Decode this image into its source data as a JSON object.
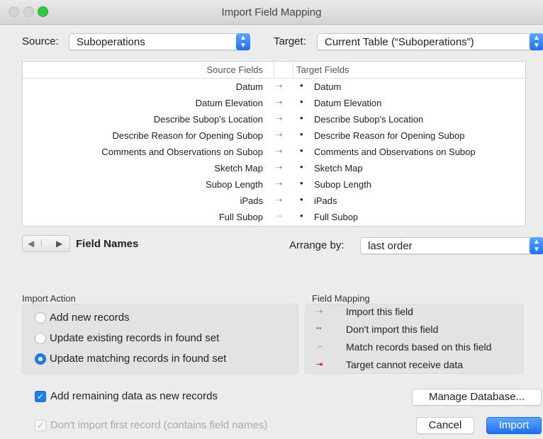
{
  "window": {
    "title": "Import Field Mapping"
  },
  "source": {
    "label": "Source:",
    "value": "Suboperations"
  },
  "target": {
    "label": "Target:",
    "value": "Current Table (“Suboperations”)"
  },
  "fields": {
    "header_source": "Source Fields",
    "header_target": "Target Fields",
    "rows": [
      {
        "source": "Datum",
        "target": "Datum",
        "mapping": "import"
      },
      {
        "source": "Datum Elevation",
        "target": "Datum Elevation",
        "mapping": "import"
      },
      {
        "source": "Describe Subop's Location",
        "target": "Describe Subop's Location",
        "mapping": "import"
      },
      {
        "source": "Describe Reason for Opening Subop",
        "target": "Describe Reason for Opening Subop",
        "mapping": "import"
      },
      {
        "source": "Comments and Observations on Subop",
        "target": "Comments and Observations on Subop",
        "mapping": "import"
      },
      {
        "source": "Sketch Map",
        "target": "Sketch Map",
        "mapping": "import"
      },
      {
        "source": "Subop Length",
        "target": "Subop Length",
        "mapping": "import"
      },
      {
        "source": "iPads",
        "target": "iPads",
        "mapping": "import"
      },
      {
        "source": "Full Subop",
        "target": "Full Subop",
        "mapping": "match"
      }
    ],
    "mapping_glyphs": {
      "import": "⇢",
      "match": "⇔"
    }
  },
  "pager": {
    "label": "Field Names"
  },
  "arrange": {
    "label": "Arrange by:",
    "value": "last order"
  },
  "import_action": {
    "title": "Import Action",
    "options": [
      {
        "label": "Add new records",
        "selected": false
      },
      {
        "label": "Update existing records in found set",
        "selected": false
      },
      {
        "label": "Update matching records in found set",
        "selected": true
      }
    ]
  },
  "field_mapping": {
    "title": "Field Mapping",
    "items": [
      {
        "icon": "import-arrow-icon",
        "glyph": "⇢",
        "label": "Import this field"
      },
      {
        "icon": "dont-import-icon",
        "glyph": "••",
        "label": "Don't import this field"
      },
      {
        "icon": "match-arrow-icon",
        "glyph": "⇔",
        "label": "Match records based on this field"
      },
      {
        "icon": "cannot-receive-icon",
        "glyph": "⇥",
        "label": "Target cannot receive data"
      }
    ]
  },
  "add_remaining": {
    "label": "Add remaining data as new records",
    "checked": true
  },
  "dont_import_first": {
    "label": "Don't import first record (contains field names)",
    "checked": true,
    "disabled": true
  },
  "buttons": {
    "manage": "Manage Database...",
    "cancel": "Cancel",
    "import": "Import"
  },
  "colors": {
    "accent": "#1e7bf0",
    "window_bg": "#ececec",
    "red": "#d0021b"
  }
}
